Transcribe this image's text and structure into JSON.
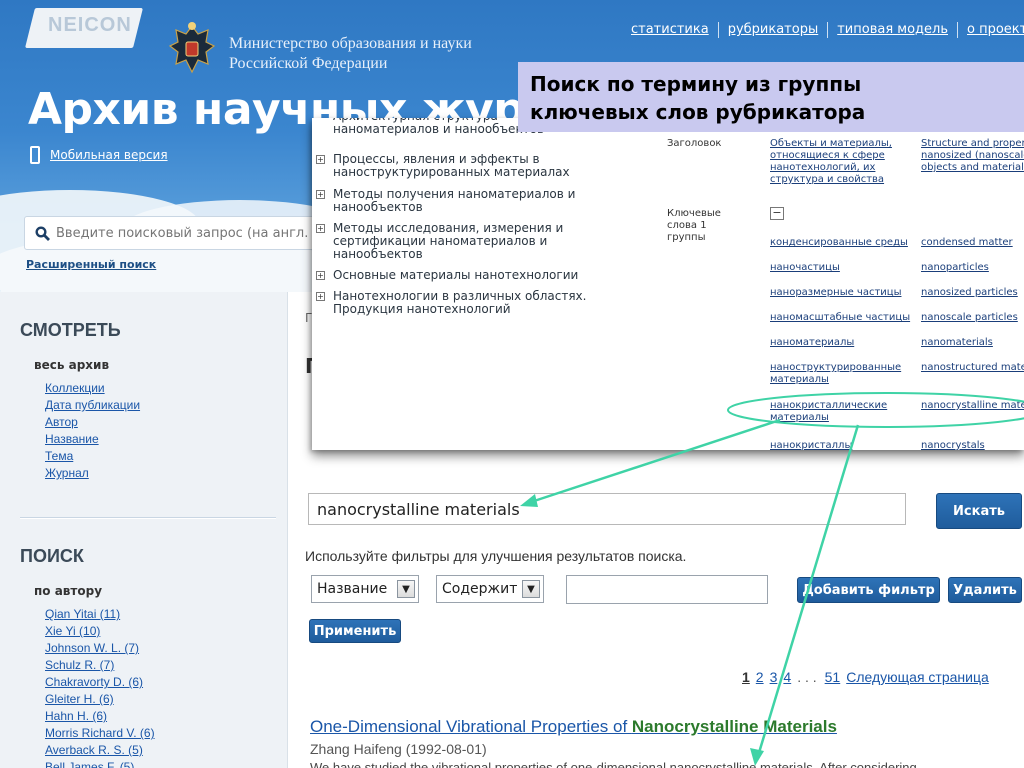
{
  "header": {
    "logo": "NEICON",
    "ministry": "Министерство образования и науки Российской Федерации",
    "nav": [
      "статистика",
      "рубрикаторы",
      "типовая модель",
      "о проекте"
    ],
    "title": "Архив научных журналов",
    "mobile_link": "Мобильная версия",
    "search_placeholder": "Введите поисковый запрос (на англ.",
    "advanced_search": "Расширенный поиск"
  },
  "callout": {
    "line1": "Поиск по термину из  группы",
    "line2": "ключевых слов  рубрикатора"
  },
  "overlay": {
    "tree": [
      {
        "toggle": "",
        "label": "Архитектурная структура наноматериалов и нанообъектов"
      },
      {
        "toggle": "+",
        "label": "Процессы, явления и эффекты в наноструктурированных материалах"
      },
      {
        "toggle": "+",
        "label": "Методы получения наноматериалов и нанообъектов"
      },
      {
        "toggle": "+",
        "label": "Методы исследования, измерения и сертификации наноматериалов и нанообъектов"
      },
      {
        "toggle": "+",
        "label": "Основные материалы нанотехнологии"
      },
      {
        "toggle": "+",
        "label": "Нанотехнологии в различных областях. Продукция нанотехнологий"
      }
    ],
    "heading_label": "Заголовок",
    "heading_ru": "Объекты и материалы, относящиеся к сфере нанотехнологий, их структура и свойства",
    "heading_en": "Structure and properties of nanosized (nanoscale) objects and materials",
    "keywords_label": "Ключевые слова 1 группы",
    "collapse_toggle": "−",
    "keywords": [
      {
        "ru": "конденсированные среды",
        "en": "condensed matter"
      },
      {
        "ru": "наночастицы",
        "en": "nanoparticles"
      },
      {
        "ru": "наноразмерные частицы",
        "en": "nanosized particles"
      },
      {
        "ru": "наномасштабные частицы",
        "en": "nanoscale particles"
      },
      {
        "ru": "наноматериалы",
        "en": "nanomaterials"
      },
      {
        "ru": "наноструктурированные материалы",
        "en": "nanostructured materials"
      },
      {
        "ru": "нанокристаллические материалы",
        "en": "nanocrystalline materials"
      },
      {
        "ru": "нанокристаллы",
        "en": "nanocrystals"
      }
    ]
  },
  "sidebar": {
    "view_heading": "СМОТРЕТЬ",
    "view_sub": "весь архив",
    "view_items": [
      "Коллекции",
      "Дата публикации",
      "Автор",
      "Название",
      "Тема",
      "Журнал"
    ],
    "search_heading": "ПОИСК",
    "search_sub": "по автору",
    "authors": [
      "Qian Yitai (11)",
      "Xie Yi (10)",
      "Johnson W. L. (7)",
      "Schulz R. (7)",
      "Chakravorty D. (6)",
      "Gleiter H. (6)",
      "Hahn H. (6)",
      "Morris Richard V. (6)",
      "Averback R. S. (5)",
      "Bell James F. (5)"
    ]
  },
  "main": {
    "breadcrumb_fragment": "Г",
    "heading_fragment": "П",
    "search_value": "nanocrystalline materials",
    "search_button": "Искать",
    "filters_hint": "Используйте фильтры для улучшения результатов поиска.",
    "filter_field": "Название",
    "filter_op": "Содержит",
    "filter_value": "",
    "add_filter": "Добавить фильтр",
    "delete": "Удалить",
    "apply": "Применить",
    "pages": [
      "1",
      "2",
      "3",
      "4"
    ],
    "ellipsis": ". . .",
    "last_page": "51",
    "next_page": "Следующая страница",
    "result": {
      "title_prefix": "One-Dimensional Vibrational Properties of ",
      "title_highlight": "Nanocrystalline Materials",
      "author": "Zhang Haifeng (1992-08-01)",
      "snippet": "We have studied the vibrational properties of one-dimensional nanocrystalline materials. After considering"
    }
  },
  "colors": {
    "header_blue": "#3b86cf",
    "callout_bg": "#c9c9ef",
    "annotation": "#3fd3a6",
    "button_blue": "#2e73b8",
    "link": "#1a56a8",
    "highlight": "#2c7a2c"
  }
}
